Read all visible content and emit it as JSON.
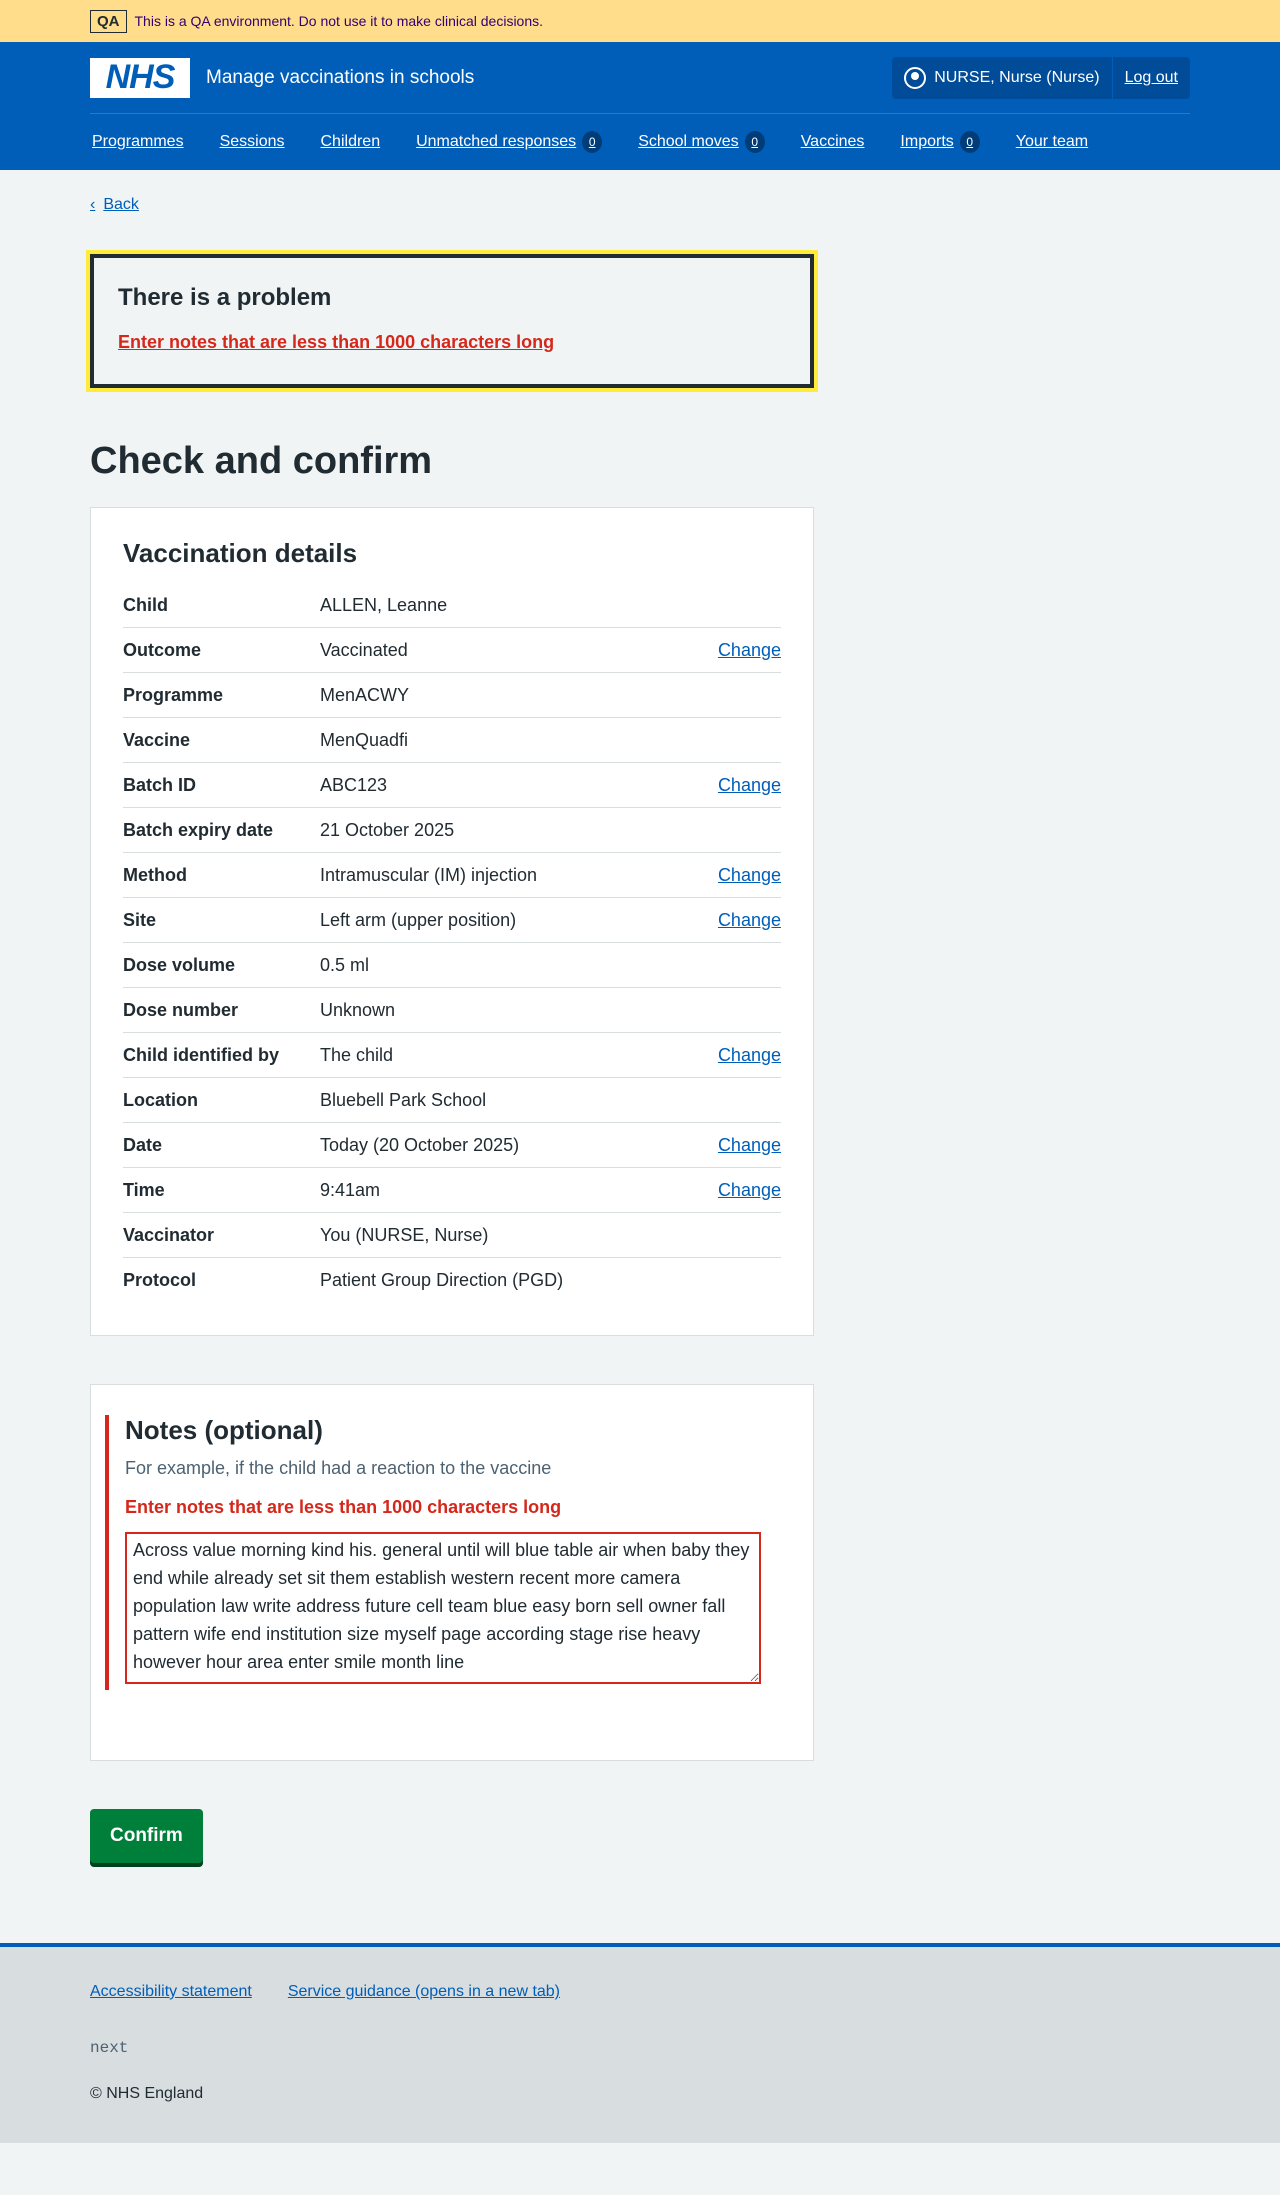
{
  "qa": {
    "tag": "QA",
    "text": "This is a QA environment. Do not use it to make clinical decisions."
  },
  "header": {
    "logo": "NHS",
    "service": "Manage vaccinations in schools",
    "user": "NURSE, Nurse (Nurse)",
    "logout": "Log out"
  },
  "nav": [
    {
      "label": "Programmes"
    },
    {
      "label": "Sessions"
    },
    {
      "label": "Children"
    },
    {
      "label": "Unmatched responses",
      "count": "0"
    },
    {
      "label": "School moves",
      "count": "0"
    },
    {
      "label": "Vaccines"
    },
    {
      "label": "Imports",
      "count": "0"
    },
    {
      "label": "Your team"
    }
  ],
  "back": "Back",
  "error_summary": {
    "title": "There is a problem",
    "message": "Enter notes that are less than 1000 characters long"
  },
  "title": "Check and confirm",
  "details": {
    "heading": "Vaccination details",
    "change_label": "Change",
    "rows": [
      {
        "k": "Child",
        "v": "ALLEN, Leanne",
        "change": false
      },
      {
        "k": "Outcome",
        "v": "Vaccinated",
        "change": true
      },
      {
        "k": "Programme",
        "v": "MenACWY",
        "change": false
      },
      {
        "k": "Vaccine",
        "v": "MenQuadfi",
        "change": false
      },
      {
        "k": "Batch ID",
        "v": "ABC123",
        "change": true
      },
      {
        "k": "Batch expiry date",
        "v": "21 October 2025",
        "change": false
      },
      {
        "k": "Method",
        "v": "Intramuscular (IM) injection",
        "change": true
      },
      {
        "k": "Site",
        "v": "Left arm (upper position)",
        "change": true
      },
      {
        "k": "Dose volume",
        "v": "0.5 ml",
        "change": false
      },
      {
        "k": "Dose number",
        "v": "Unknown",
        "change": false
      },
      {
        "k": "Child identified by",
        "v": "The child",
        "change": true
      },
      {
        "k": "Location",
        "v": "Bluebell Park School",
        "change": false
      },
      {
        "k": "Date",
        "v": "Today (20 October 2025)",
        "change": true
      },
      {
        "k": "Time",
        "v": "9:41am",
        "change": true
      },
      {
        "k": "Vaccinator",
        "v": "You (NURSE, Nurse)",
        "change": false
      },
      {
        "k": "Protocol",
        "v": "Patient Group Direction (PGD)",
        "change": false
      }
    ]
  },
  "notes": {
    "heading": "Notes (optional)",
    "hint": "For example, if the child had a reaction to the vaccine",
    "error": "Enter notes that are less than 1000 characters long",
    "value": "Across value morning kind his. general until will blue table air when baby they end while already set sit them establish western recent more camera population law write address future cell team blue easy born sell owner fall pattern wife end institution size myself page according stage rise heavy however hour area enter smile month line"
  },
  "confirm": "Confirm",
  "footer": {
    "links": [
      "Accessibility statement",
      "Service guidance (opens in a new tab)"
    ],
    "version": "next",
    "copyright": "© NHS England"
  }
}
